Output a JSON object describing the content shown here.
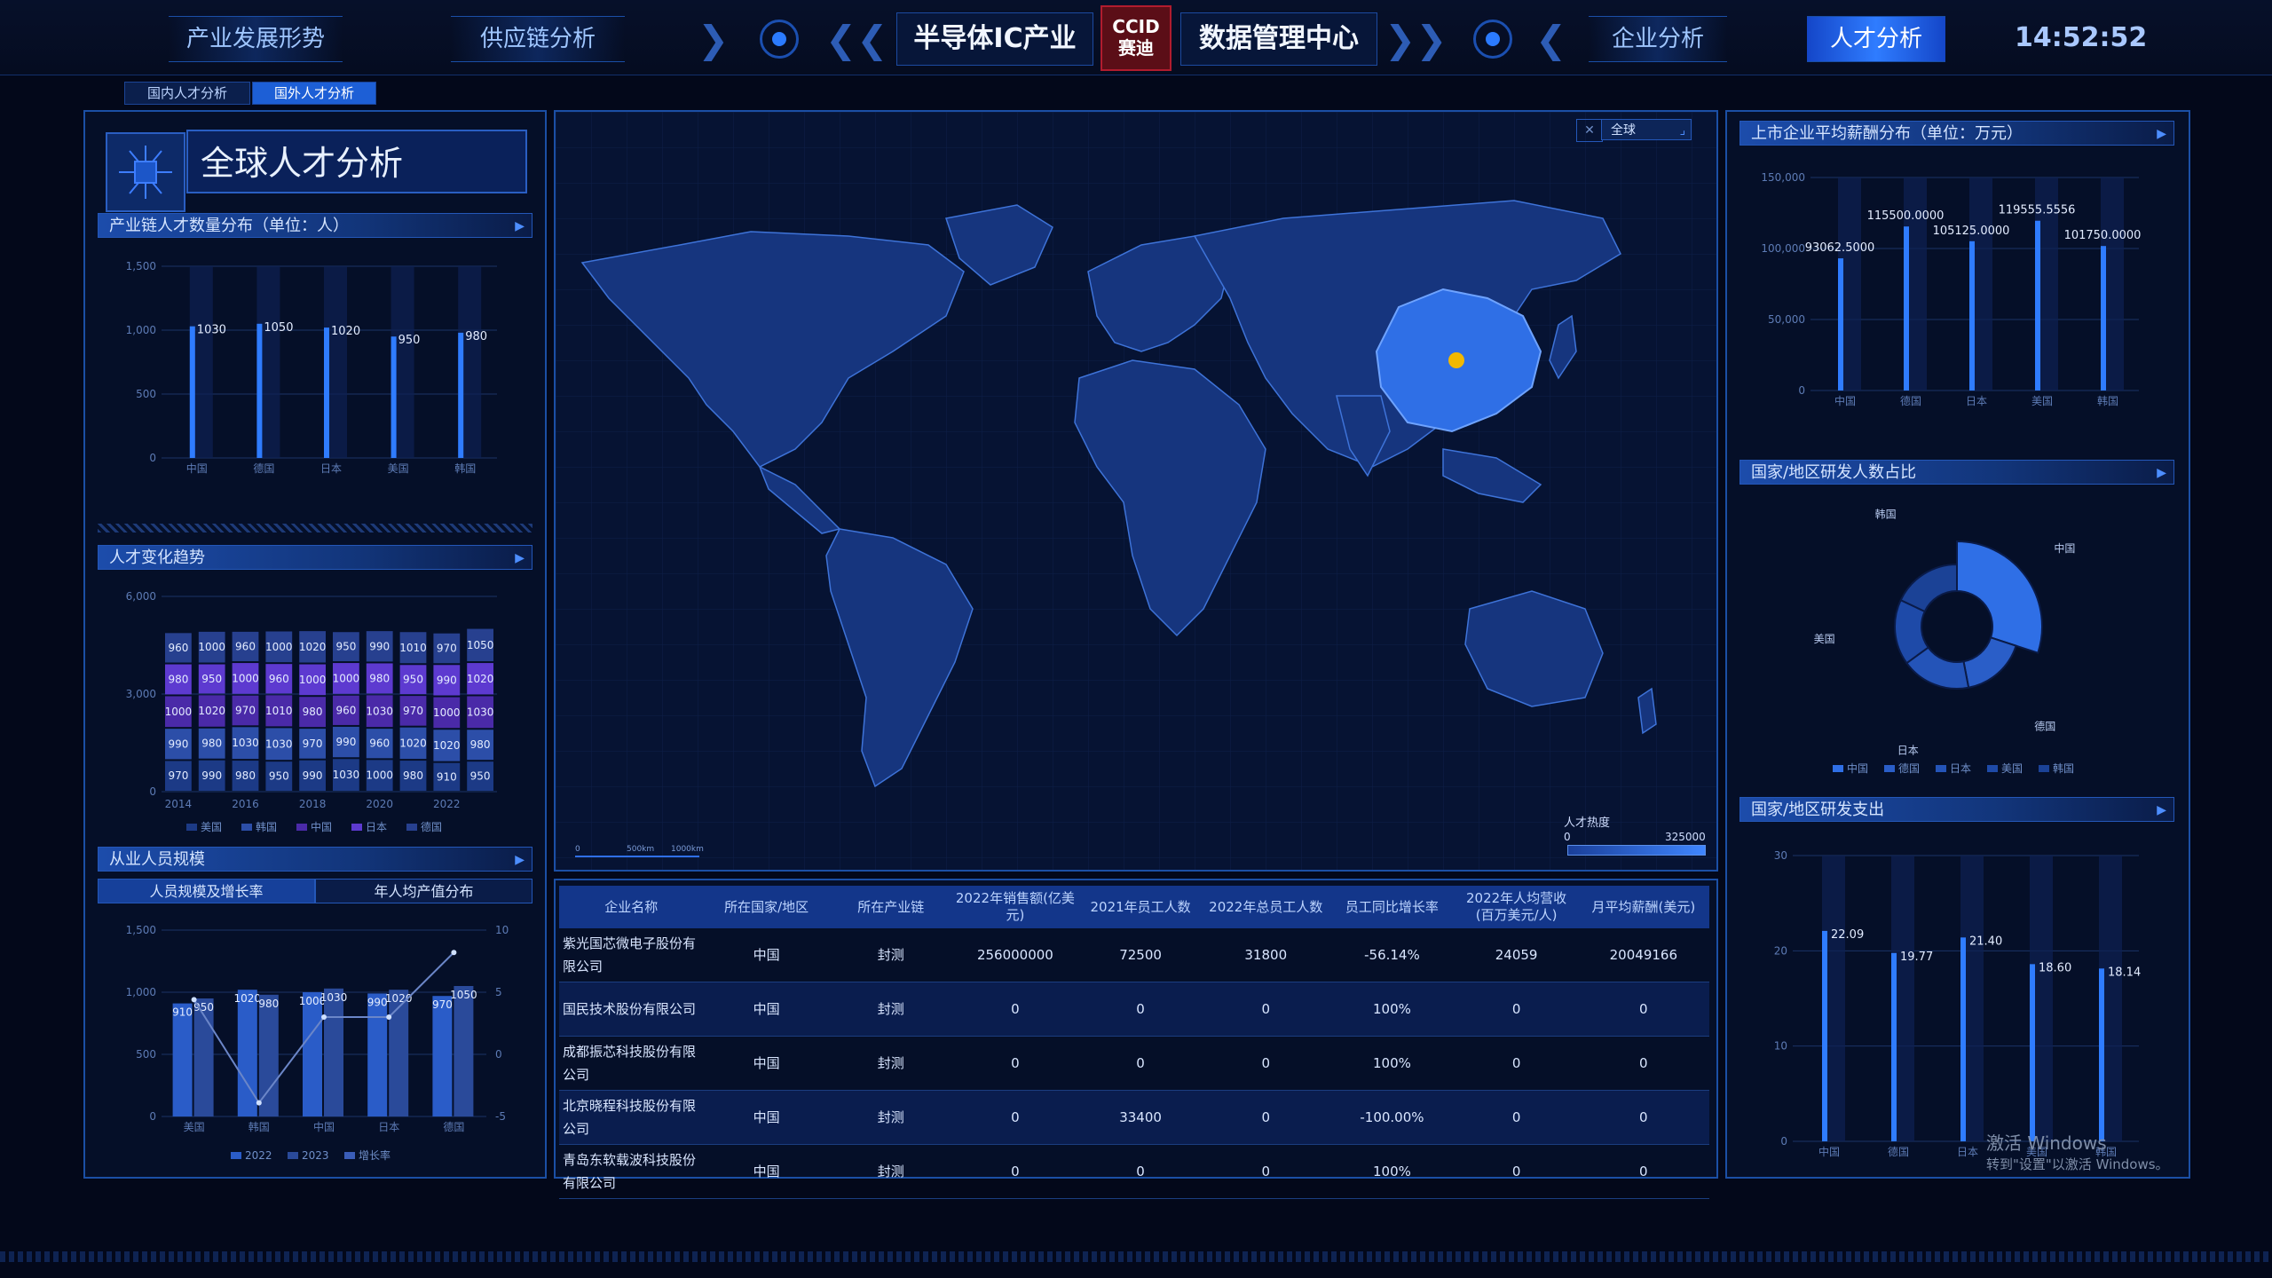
{
  "nav": {
    "left_items": [
      "产业发展形势",
      "供应链分析"
    ],
    "title_left": "半导体IC产业",
    "logo_text": "CCID\n赛迪",
    "title_right": "数据管理中心",
    "right_items": [
      "企业分析",
      "人才分析"
    ],
    "active_item": "人才分析",
    "clock": "14:52:52"
  },
  "subtabs": [
    "国内人才分析",
    "国外人才分析"
  ],
  "active_subtab": "国外人才分析",
  "left": {
    "big_title": "全球人才分析",
    "chart1_title": "产业链人才数量分布（单位：人）",
    "chart2_title": "人才变化趋势",
    "chart3_title": "从业人员规模",
    "chart3_tabs": [
      "人员规模及增长率",
      "年人均产值分布"
    ]
  },
  "map": {
    "region_select": "全球",
    "legend_title": "人才热度",
    "legend_min": "0",
    "legend_max": "325000",
    "scale_labels": [
      "0",
      "500km",
      "1000km"
    ]
  },
  "right": {
    "chart4_title": "上市企业平均薪酬分布（单位：万元）",
    "chart5_title": "国家/地区研发人数占比",
    "chart6_title": "国家/地区研发支出"
  },
  "table": {
    "headers": [
      "企业名称",
      "所在国家/地区",
      "所在产业链",
      "2022年销售额(亿美元)",
      "2021年员工人数",
      "2022年总员工人数",
      "员工同比增长率",
      "2022年人均营收(百万美元/人)",
      "月平均薪酬(美元)"
    ],
    "rows": [
      [
        "紫光国芯微电子股份有限公司",
        "中国",
        "封测",
        "256000000",
        "72500",
        "31800",
        "-56.14%",
        "24059",
        "20049166"
      ],
      [
        "国民技术股份有限公司",
        "中国",
        "封测",
        "0",
        "0",
        "0",
        "100%",
        "0",
        "0"
      ],
      [
        "成都振芯科技股份有限公司",
        "中国",
        "封测",
        "0",
        "0",
        "0",
        "100%",
        "0",
        "0"
      ],
      [
        "北京晓程科技股份有限公司",
        "中国",
        "封测",
        "0",
        "33400",
        "0",
        "-100.00%",
        "0",
        "0"
      ],
      [
        "青岛东软载波科技股份有限公司",
        "中国",
        "封测",
        "0",
        "0",
        "0",
        "100%",
        "0",
        "0"
      ]
    ]
  },
  "watermark": {
    "line1": "激活 Windows",
    "line2": "转到\"设置\"以激活 Windows。"
  },
  "colors": {
    "accent": "#2f7cff",
    "bar": "#2b6fe6",
    "bg": "#03081a",
    "china": "#2f6fe6"
  },
  "chart_data": [
    {
      "type": "bar",
      "title": "产业链人才数量分布（单位：人）",
      "categories": [
        "中国",
        "德国",
        "日本",
        "美国",
        "韩国"
      ],
      "values": [
        1030,
        1050,
        1020,
        950,
        980
      ],
      "ylim": [
        0,
        1500
      ],
      "yticks": [
        "0",
        "500",
        "1,000",
        "1,500"
      ]
    },
    {
      "type": "bar",
      "title": "人才变化趋势",
      "stacked": true,
      "categories": [
        "2014",
        "2015",
        "2016",
        "2017",
        "2018",
        "2019",
        "2020",
        "2021",
        "2022",
        "2023"
      ],
      "xticks": [
        "2014",
        "2016",
        "2018",
        "2020",
        "2022"
      ],
      "ylim": [
        0,
        6000
      ],
      "yticks": [
        "0",
        "3,000",
        "6,000"
      ],
      "series": [
        {
          "name": "美国",
          "values": [
            970,
            990,
            980,
            950,
            990,
            1030,
            1000,
            980,
            910,
            950
          ]
        },
        {
          "name": "韩国",
          "values": [
            990,
            980,
            1030,
            1030,
            970,
            990,
            960,
            1020,
            1020,
            980
          ]
        },
        {
          "name": "中国",
          "values": [
            1000,
            1020,
            970,
            1010,
            980,
            960,
            1030,
            970,
            1000,
            1030
          ]
        },
        {
          "name": "日本",
          "values": [
            980,
            950,
            1000,
            960,
            1000,
            1000,
            980,
            950,
            990,
            1020
          ]
        },
        {
          "name": "德国",
          "values": [
            960,
            1000,
            960,
            1000,
            1020,
            950,
            990,
            1010,
            970,
            1050
          ]
        }
      ]
    },
    {
      "type": "bar",
      "title": "从业人员规模",
      "categories": [
        "美国",
        "韩国",
        "中国",
        "日本",
        "德国"
      ],
      "series": [
        {
          "name": "2022",
          "values": [
            910,
            1020,
            1000,
            990,
            970
          ]
        },
        {
          "name": "2023",
          "values": [
            950,
            980,
            1030,
            1020,
            1050
          ]
        },
        {
          "name": "增长率",
          "type": "line",
          "values": [
            4.4,
            -3.9,
            3.0,
            3.0,
            8.2
          ]
        }
      ],
      "ylim": [
        0,
        1500
      ],
      "yticks": [
        "0",
        "500",
        "1,000",
        "1,500"
      ],
      "y2lim": [
        -5,
        10
      ],
      "y2ticks": [
        "-5",
        "0",
        "5",
        "10"
      ]
    },
    {
      "type": "bar",
      "title": "上市企业平均薪酬分布（单位：万元）",
      "categories": [
        "中国",
        "德国",
        "日本",
        "美国",
        "韩国"
      ],
      "values": [
        93062.5,
        115500,
        105125,
        119555.5556,
        101750
      ],
      "labels": [
        "93062.5000",
        "115500.0000",
        "105125.0000",
        "119555.5556",
        "101750.0000"
      ],
      "ylim": [
        0,
        150000
      ],
      "yticks": [
        "0",
        "50,000",
        "100,000",
        "150,000"
      ]
    },
    {
      "type": "pie",
      "title": "国家/地区研发人数占比",
      "categories": [
        "中国",
        "德国",
        "日本",
        "美国",
        "韩国"
      ],
      "values": [
        30,
        17,
        18,
        17,
        18
      ]
    },
    {
      "type": "bar",
      "title": "国家/地区研发支出",
      "categories": [
        "中国",
        "德国",
        "日本",
        "美国",
        "韩国"
      ],
      "values": [
        22.09,
        19.77,
        21.4,
        18.6,
        18.14
      ],
      "labels": [
        "22.09",
        "19.77",
        "21.40",
        "18.60",
        "18.14"
      ],
      "ylim": [
        0,
        30
      ],
      "yticks": [
        "0",
        "10",
        "20",
        "30"
      ]
    }
  ]
}
